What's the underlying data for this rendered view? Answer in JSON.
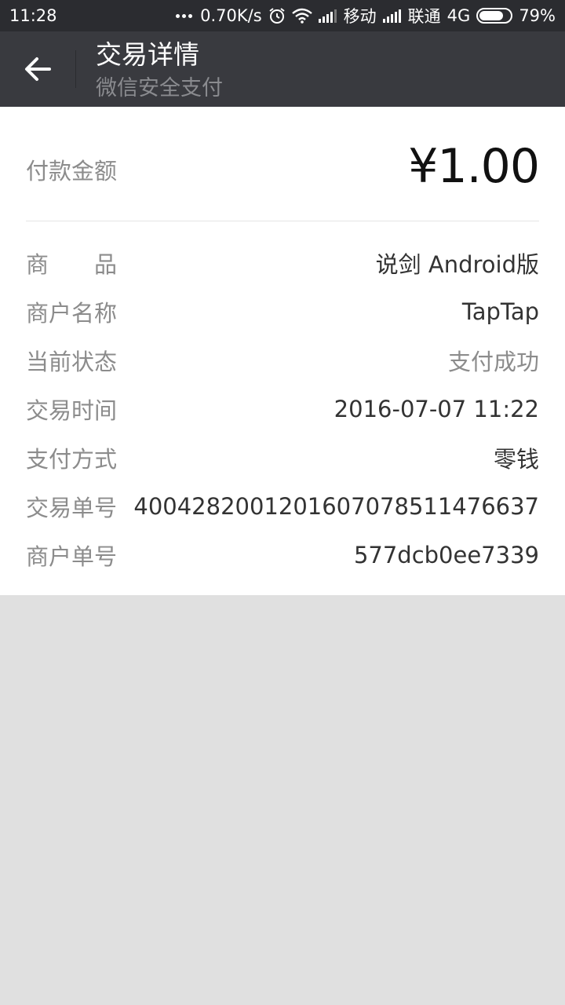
{
  "status_bar": {
    "time": "11:28",
    "net_speed": "0.70K/s",
    "carrier1": "移动",
    "carrier2": "联通",
    "network_type": "4G",
    "battery_percent": "79%",
    "battery_level": 0.79
  },
  "header": {
    "title": "交易详情",
    "subtitle": "微信安全支付",
    "back_icon": "arrow-left-icon"
  },
  "amount": {
    "label": "付款金额",
    "value": "¥1.00"
  },
  "details": [
    {
      "label": "商品",
      "value": "说剑 Android版"
    },
    {
      "label": "商户名称",
      "value": "TapTap"
    },
    {
      "label": "当前状态",
      "value": "支付成功"
    },
    {
      "label": "交易时间",
      "value": "2016-07-07 11:22"
    },
    {
      "label": "支付方式",
      "value": "零钱"
    },
    {
      "label": "交易单号",
      "value": "4004282001201607078511476637"
    },
    {
      "label": "商户单号",
      "value": "577dcb0ee7339"
    }
  ],
  "colors": {
    "status_bar_bg": "#2b2c30",
    "title_bar_bg": "#393a3f",
    "page_bg": "#e0e0e0"
  }
}
